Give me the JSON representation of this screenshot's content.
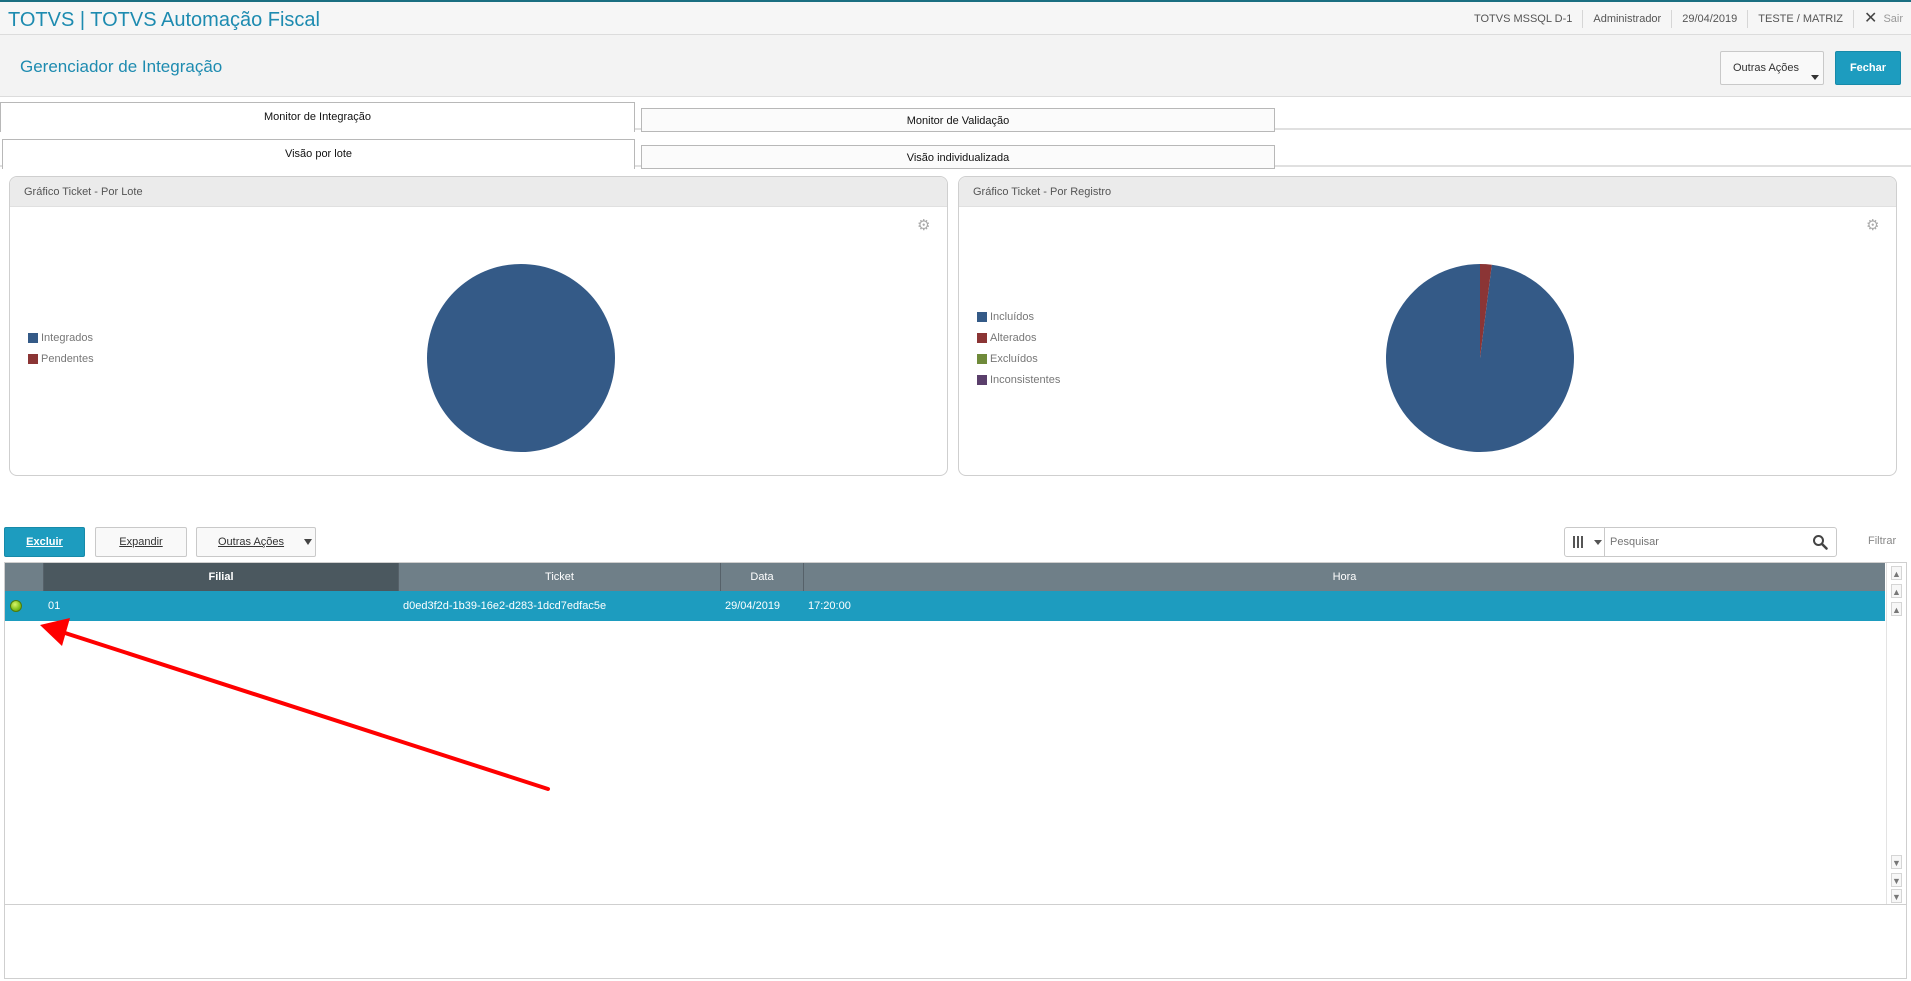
{
  "app": {
    "title": "TOTVS | TOTVS Automação Fiscal",
    "environment": "TOTVS  MSSQL D-1",
    "user": "Administrador",
    "date": "29/04/2019",
    "company": "TESTE / MATRIZ",
    "logout_label": "Sair"
  },
  "header": {
    "title": "Gerenciador de Integração",
    "more_actions_label": "Outras Ações",
    "close_label": "Fechar"
  },
  "tabs_top": [
    {
      "label": "Monitor de Integração",
      "active": true
    },
    {
      "label": "Monitor de Validação",
      "active": false
    }
  ],
  "tabs_sub": [
    {
      "label": "Visão por lote",
      "active": true
    },
    {
      "label": "Visão individualizada",
      "active": false
    }
  ],
  "charts": {
    "lote": {
      "title": "Gráfico Ticket - Por Lote",
      "legend": [
        {
          "label": "Integrados",
          "color": "#345a87"
        },
        {
          "label": "Pendentes",
          "color": "#8b3535"
        }
      ]
    },
    "registro": {
      "title": "Gráfico Ticket - Por Registro",
      "legend": [
        {
          "label": "Incluídos",
          "color": "#345a87"
        },
        {
          "label": "Alterados",
          "color": "#8b3535"
        },
        {
          "label": "Excluídos",
          "color": "#6f8a3a"
        },
        {
          "label": "Inconsistentes",
          "color": "#5a3f6b"
        }
      ]
    }
  },
  "chart_data": [
    {
      "type": "pie",
      "title": "Gráfico Ticket - Por Lote",
      "categories": [
        "Integrados",
        "Pendentes"
      ],
      "values": [
        100,
        0
      ],
      "legend": "left"
    },
    {
      "type": "pie",
      "title": "Gráfico Ticket - Por Registro",
      "categories": [
        "Incluídos",
        "Alterados",
        "Excluídos",
        "Inconsistentes"
      ],
      "values": [
        98,
        2,
        0,
        0
      ],
      "legend": "left"
    }
  ],
  "toolbar": {
    "delete_label": "Excluir",
    "expand_label": "Expandir",
    "more_actions_label": "Outras Ações",
    "search_placeholder": "Pesquisar",
    "filter_label": "Filtrar"
  },
  "grid": {
    "columns": [
      "",
      "Filial",
      "Ticket",
      "Data",
      "Hora"
    ],
    "rows": [
      {
        "status": "green",
        "filial": "01",
        "ticket": "d0ed3f2d-1b39-16e2-d283-1dcd7edfac5e",
        "data": "29/04/2019",
        "hora": "17:20:00"
      }
    ]
  },
  "annotation": {
    "color": "#ff0000"
  }
}
